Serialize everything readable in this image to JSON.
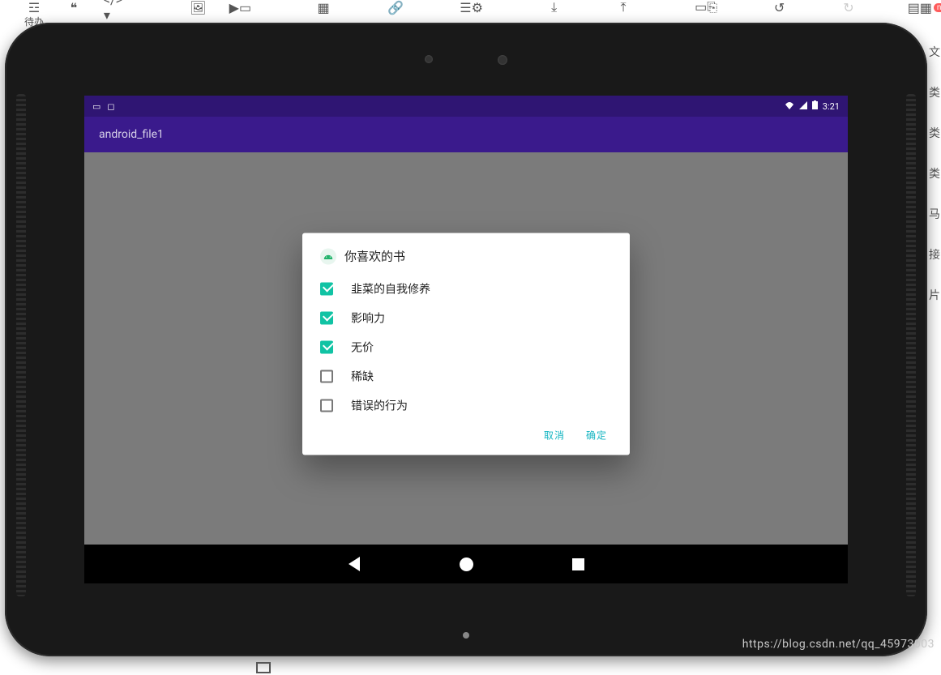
{
  "editor_toolbar": {
    "left_label": "待办",
    "new_badge": "new"
  },
  "right_strip_chars": [
    "文",
    "",
    "",
    "",
    "",
    "",
    "类",
    "类",
    "类",
    "马",
    "接",
    "片"
  ],
  "status": {
    "time": "3:21"
  },
  "appbar": {
    "title": "android_file1"
  },
  "dialog": {
    "title": "你喜欢的书",
    "options": [
      {
        "label": "韭菜的自我修养",
        "checked": true
      },
      {
        "label": "影响力",
        "checked": true
      },
      {
        "label": "无价",
        "checked": true
      },
      {
        "label": "稀缺",
        "checked": false
      },
      {
        "label": "错误的行为",
        "checked": false
      }
    ],
    "cancel": "取消",
    "confirm": "确定"
  },
  "watermark": "https://blog.csdn.net/qq_45973003"
}
